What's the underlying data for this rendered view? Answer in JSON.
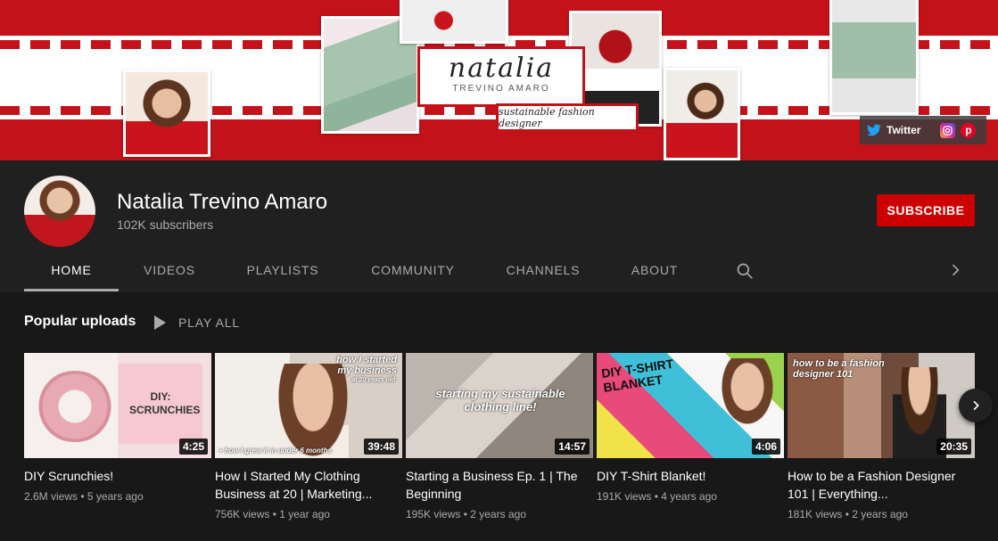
{
  "banner": {
    "logo_script": "natalia",
    "logo_sub": "TREVINO AMARO",
    "tagline": "sustainable fashion designer",
    "social": {
      "twitter_label": "Twitter",
      "icons": [
        "twitter-icon",
        "instagram-icon",
        "pinterest-icon"
      ]
    }
  },
  "channel": {
    "name": "Natalia Trevino Amaro",
    "subscribers": "102K subscribers",
    "subscribe_label": "SUBSCRIBE"
  },
  "tabs": [
    "HOME",
    "VIDEOS",
    "PLAYLISTS",
    "COMMUNITY",
    "CHANNELS",
    "ABOUT"
  ],
  "section": {
    "title": "Popular uploads",
    "play_all": "PLAY ALL"
  },
  "videos": [
    {
      "title": "DIY Scrunchies!",
      "duration": "4:25",
      "views": "2.6M views",
      "age": "5 years ago",
      "thumb_text": "DIY: SCRUNCHIES"
    },
    {
      "title": "How I Started My Clothing Business at 20 | Marketing...",
      "duration": "39:48",
      "views": "756K views",
      "age": "1 year ago",
      "thumb_text": "how I started my business",
      "thumb_sub": "at 20 years old",
      "thumb_foot": "+ how I grew it in under 6 months"
    },
    {
      "title": "Starting a Business Ep. 1 | The Beginning",
      "duration": "14:57",
      "views": "195K views",
      "age": "2 years ago",
      "thumb_text": "starting my sustainable clothing line!"
    },
    {
      "title": "DIY T-Shirt Blanket!",
      "duration": "4:06",
      "views": "191K views",
      "age": "4 years ago",
      "thumb_text": "DIY T-SHIRT BLANKET"
    },
    {
      "title": "How to be a Fashion Designer 101 | Everything...",
      "duration": "20:35",
      "views": "181K views",
      "age": "2 years ago",
      "thumb_text": "how to be a fashion designer 101"
    }
  ],
  "colors": {
    "accent": "#cc0000",
    "banner_red": "#c4121a",
    "background": "#181818",
    "header_bg": "#202020",
    "muted_text": "#aaaaaa"
  }
}
